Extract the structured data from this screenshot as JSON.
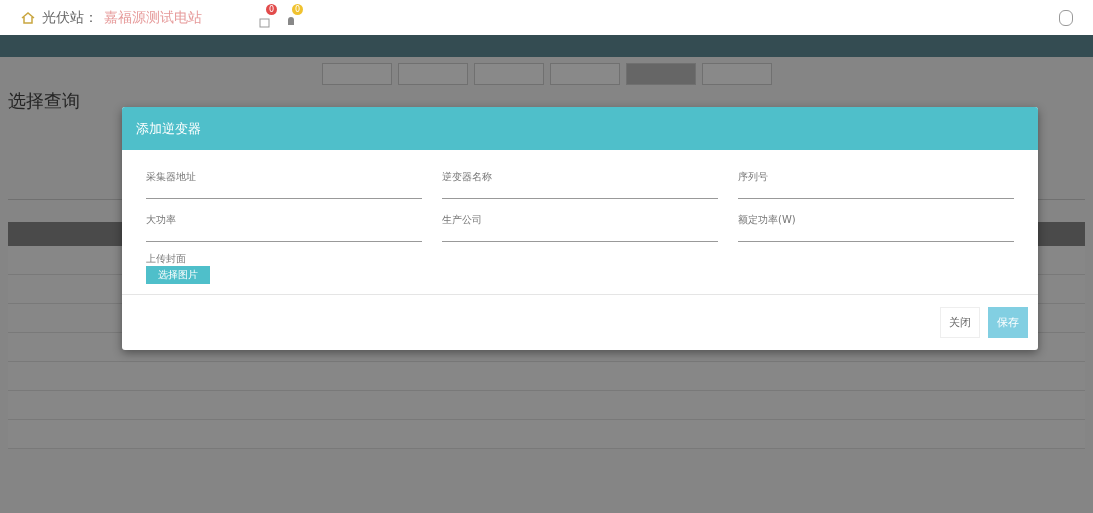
{
  "header": {
    "station_label": "光伏站：",
    "station_name": "嘉福源测试电站",
    "message_badge": "0",
    "alert_badge": "0"
  },
  "page": {
    "title": "选择查询",
    "tabs": [
      {
        "selected": false
      },
      {
        "selected": false
      },
      {
        "selected": false
      },
      {
        "selected": false
      },
      {
        "selected": true
      },
      {
        "selected": false
      }
    ]
  },
  "dialog": {
    "title": "添加逆变器",
    "fields": [
      {
        "label": "采集器地址"
      },
      {
        "label": "逆变器名称"
      },
      {
        "label": "序列号"
      },
      {
        "label": "大功率"
      },
      {
        "label": "生产公司"
      },
      {
        "label": "额定功率(W)"
      }
    ],
    "upload_label": "上传封面",
    "upload_button": "选择图片",
    "buttons": [
      {
        "label": "关闭",
        "kind": "default"
      },
      {
        "label": "保存",
        "kind": "primary"
      }
    ]
  }
}
